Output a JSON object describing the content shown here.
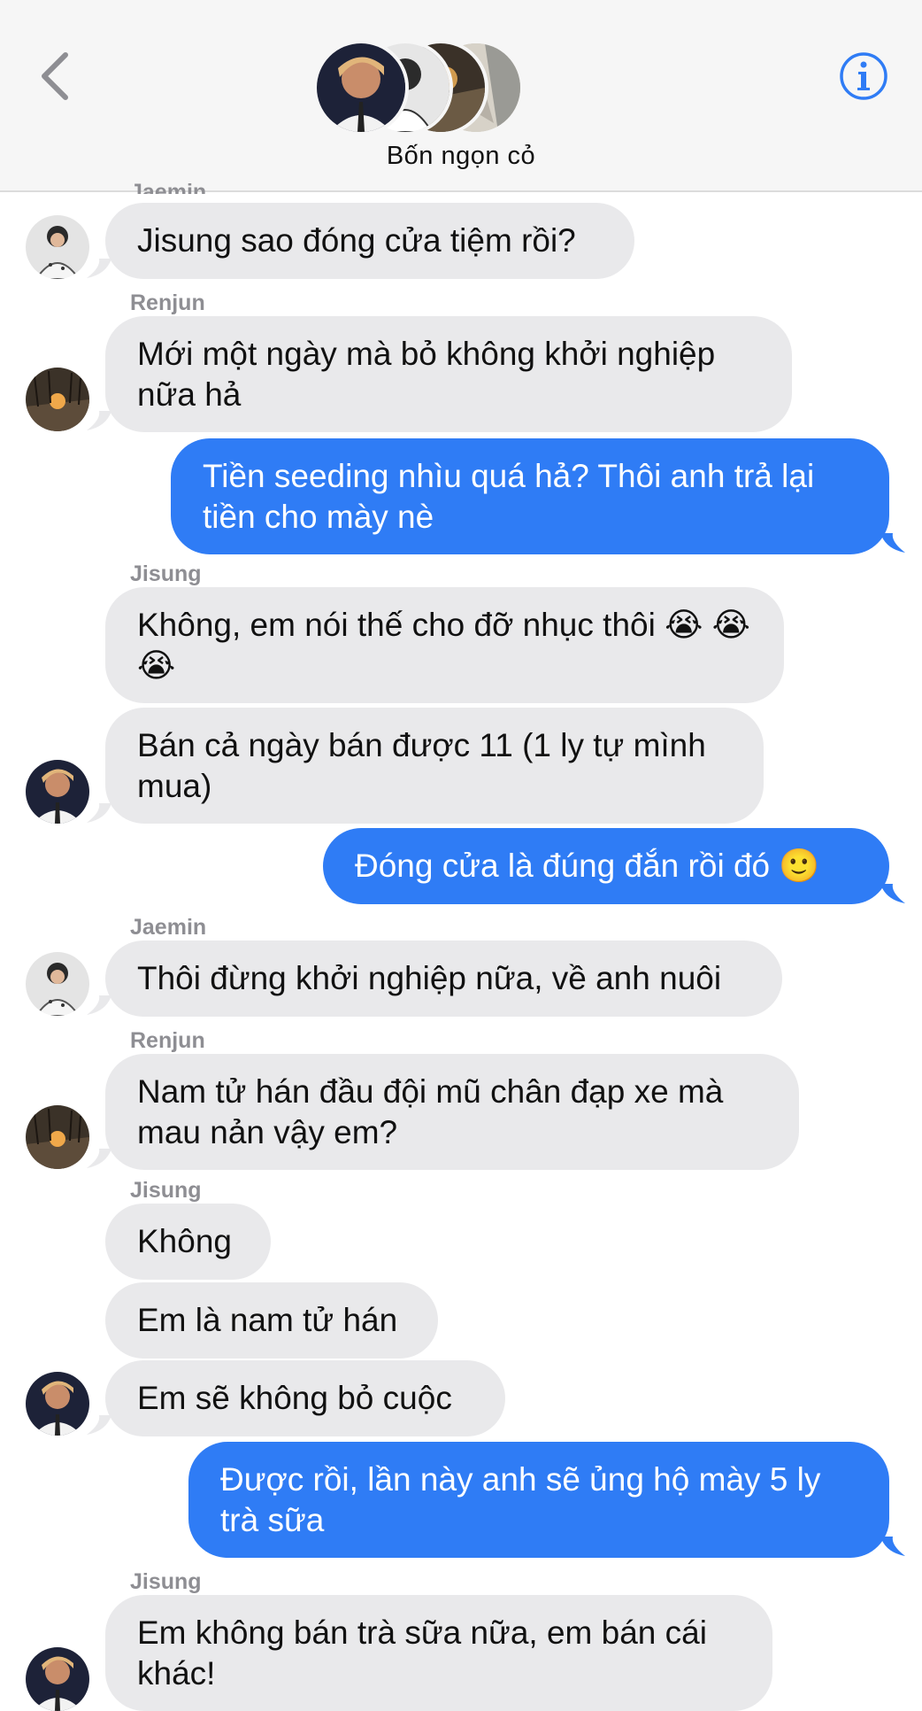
{
  "header": {
    "group_name": "Bốn ngọn cỏ",
    "back_icon": "chevron-left-icon",
    "info_icon": "info-circle-icon",
    "accent_color": "#2f7cf5"
  },
  "colors": {
    "incoming_bubble": "#e9e9eb",
    "outgoing_bubble": "#2f7cf5",
    "sender_label": "#8e8e93"
  },
  "partial_sender_top": "Jaemin",
  "senders": {
    "s1": "Renjun",
    "s2": "Jisung",
    "s3": "Jaemin",
    "s4": "Renjun",
    "s5": "Jisung",
    "s6": "Jisung"
  },
  "messages": {
    "m1": "Jisung sao đóng cửa tiệm rồi?",
    "m2": "Mới một ngày mà bỏ không khởi nghiệp nữa hả",
    "m3": "Tiền seeding nhìu quá hả? Thôi anh trả lại tiền cho mày nè",
    "m4": "Không, em nói thế cho đỡ nhục thôi 😭 😭 😭",
    "m5": "Bán cả ngày bán được 11 (1 ly tự mình mua)",
    "m6": "Đóng cửa là đúng đắn rồi đó 🙂",
    "m7": "Thôi đừng khởi nghiệp nữa, về anh nuôi",
    "m8": "Nam tử hán đầu đội mũ chân đạp xe mà mau nản vậy em?",
    "m9": "Không",
    "m10": "Em là nam tử hán",
    "m11": "Em sẽ không bỏ cuộc",
    "m12": "Được rồi, lần này anh sẽ ủng hộ mày 5 ly trà sữa",
    "m13": "Em không bán trà sữa nữa, em bán cái khác!"
  }
}
